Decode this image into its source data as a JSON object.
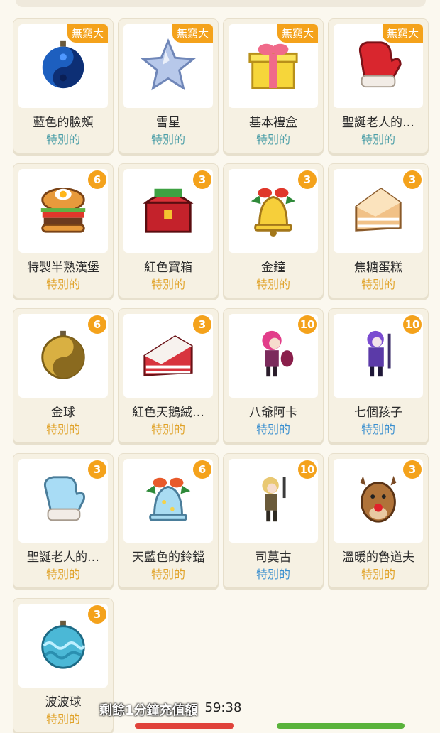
{
  "items": [
    {
      "name": "藍色的臉頰",
      "category": "特別的",
      "badge": "無窮大",
      "icon": "blue-ornament-icon",
      "catColor": "teal"
    },
    {
      "name": "雪星",
      "category": "特別的",
      "badge": "無窮大",
      "icon": "star-icon",
      "catColor": "teal"
    },
    {
      "name": "基本禮盒",
      "category": "特別的",
      "badge": "無窮大",
      "icon": "gift-box-icon",
      "catColor": "teal"
    },
    {
      "name": "聖誕老人的…",
      "category": "特別的",
      "badge": "無窮大",
      "icon": "red-mitten-icon",
      "catColor": "teal"
    },
    {
      "name": "特製半熟漢堡",
      "category": "特別的",
      "badge": "6",
      "icon": "burger-icon",
      "catColor": "gold"
    },
    {
      "name": "紅色寶箱",
      "category": "特別的",
      "badge": "3",
      "icon": "treasure-chest-icon",
      "catColor": "gold"
    },
    {
      "name": "金鐘",
      "category": "特別的",
      "badge": "3",
      "icon": "gold-bell-icon",
      "catColor": "gold"
    },
    {
      "name": "焦糖蛋糕",
      "category": "特別的",
      "badge": "3",
      "icon": "caramel-cake-icon",
      "catColor": "gold"
    },
    {
      "name": "金球",
      "category": "特別的",
      "badge": "6",
      "icon": "gold-ornament-icon",
      "catColor": "gold"
    },
    {
      "name": "紅色天鵝絨…",
      "category": "特別的",
      "badge": "3",
      "icon": "red-velvet-cake-icon",
      "catColor": "gold"
    },
    {
      "name": "八爺阿卡",
      "category": "特別的",
      "badge": "10",
      "icon": "character-pink-hair-icon",
      "catColor": "blue"
    },
    {
      "name": "七個孩子",
      "category": "特別的",
      "badge": "10",
      "icon": "character-purple-icon",
      "catColor": "blue"
    },
    {
      "name": "聖誕老人的…",
      "category": "特別的",
      "badge": "3",
      "icon": "blue-mitten-icon",
      "catColor": "gold"
    },
    {
      "name": "天藍色的鈴鐺",
      "category": "特別的",
      "badge": "6",
      "icon": "blue-bell-icon",
      "catColor": "gold"
    },
    {
      "name": "司莫古",
      "category": "特別的",
      "badge": "10",
      "icon": "character-blonde-icon",
      "catColor": "blue"
    },
    {
      "name": "溫暖的魯道夫",
      "category": "特別的",
      "badge": "3",
      "icon": "reindeer-icon",
      "catColor": "gold"
    },
    {
      "name": "波波球",
      "category": "特別的",
      "badge": "3",
      "icon": "wave-ornament-icon",
      "catColor": "gold"
    }
  ],
  "overlay": {
    "label": "剩餘1分鐘充值額",
    "clock": "59:38"
  }
}
